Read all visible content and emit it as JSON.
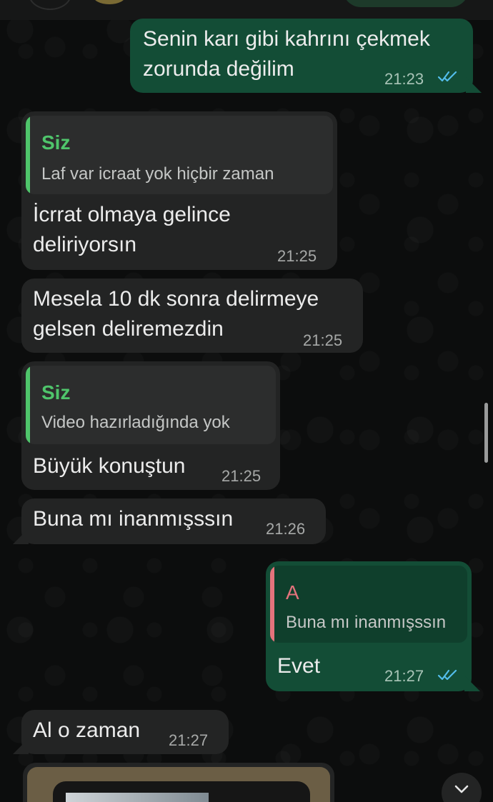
{
  "chat": {
    "messages": [
      {
        "direction": "out",
        "text_lines": [
          "Senin karı gibi kahrını çekmek",
          "zorunda değilim"
        ],
        "time": "21:23",
        "read": true
      },
      {
        "direction": "in",
        "quote": {
          "name": "Siz",
          "text": "Laf var icraat yok hiçbir zaman"
        },
        "text_lines": [
          "İcrrat olmaya gelince",
          "deliriyorsın"
        ],
        "time": "21:25"
      },
      {
        "direction": "in",
        "text_lines": [
          "Mesela 10 dk sonra delirmeye",
          "gelsen deliremezdin"
        ],
        "time": "21:25"
      },
      {
        "direction": "in",
        "quote": {
          "name": "Siz",
          "text": "Video hazırladığında yok"
        },
        "text_lines": [
          "Büyük konuştun"
        ],
        "time": "21:25"
      },
      {
        "direction": "in",
        "text_lines": [
          "Buna mı inanmışssın"
        ],
        "time": "21:26"
      },
      {
        "direction": "out",
        "quote": {
          "name": "A",
          "text": "Buna mı inanmışssın"
        },
        "text_lines": [
          "Evet"
        ],
        "time": "21:27",
        "read": true
      },
      {
        "direction": "in",
        "text_lines": [
          "Al o zaman"
        ],
        "time": "21:27"
      }
    ]
  },
  "colors": {
    "incoming_bubble": "#232424",
    "outgoing_bubble": "#134d36",
    "quote_name_self": "#4fc56b",
    "quote_name_other": "#e4737c",
    "read_ticks": "#53bdeb"
  },
  "icons": {
    "read_receipt": "double-check-icon",
    "scroll_down": "chevron-down-icon"
  }
}
